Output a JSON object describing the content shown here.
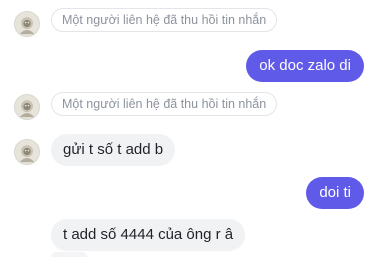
{
  "conversation": {
    "contact_avatar_icon": "lion-avatar-icon",
    "recalled_label_1": "Một người liên hệ đã thu hồi tin nhắn",
    "sent_1": "ok doc zalo di",
    "recalled_label_2": "Một người liên hệ đã thu hồi tin nhắn",
    "received_1": "gửi t số t add b",
    "sent_2": "doi ti",
    "received_2": "t add số 4444 của ông r â"
  },
  "colors": {
    "sent_bubble": "#5f5be8",
    "received_bubble": "#f1f2f4",
    "recalled_text": "#8d939c",
    "background": "#ffffff"
  }
}
